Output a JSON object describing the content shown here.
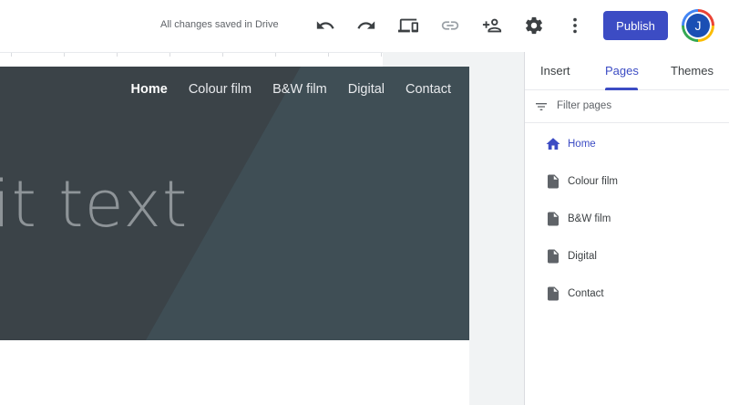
{
  "toolbar": {
    "status": "All changes saved in Drive",
    "publish_label": "Publish",
    "avatar_initial": "J"
  },
  "site": {
    "nav": [
      "Home",
      "Colour film",
      "B&W film",
      "Digital",
      "Contact"
    ],
    "hero_text": "it text"
  },
  "panel": {
    "tabs": [
      "Insert",
      "Pages",
      "Themes"
    ],
    "active_tab": "Pages",
    "filter_placeholder": "Filter pages",
    "pages": [
      {
        "label": "Home",
        "icon": "home-icon",
        "active": true
      },
      {
        "label": "Colour film",
        "icon": "page-icon",
        "active": false
      },
      {
        "label": "B&W film",
        "icon": "page-icon",
        "active": false
      },
      {
        "label": "Digital",
        "icon": "page-icon",
        "active": false
      },
      {
        "label": "Contact",
        "icon": "page-icon",
        "active": false
      }
    ]
  },
  "colors": {
    "accent": "#3c4cc4",
    "hero_bg": "#3c454b"
  }
}
